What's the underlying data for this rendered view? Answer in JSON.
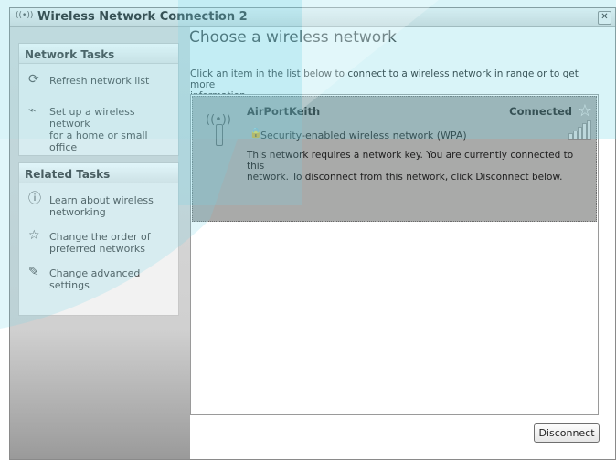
{
  "window": {
    "title": "Wireless Network Connection 2",
    "title_icon": "wireless-antenna-icon",
    "close_glyph": "✕"
  },
  "left_pane": {
    "network_tasks": {
      "header": "Network Tasks",
      "items": [
        {
          "label_lines": [
            "Refresh network list"
          ],
          "icon": "refresh-icon"
        },
        {
          "label_lines": [
            "Set up a wireless network",
            "for a home or small office"
          ],
          "icon": "setup-network-icon"
        }
      ]
    },
    "related_tasks": {
      "header": "Related Tasks",
      "items": [
        {
          "label_lines": [
            "Learn about wireless",
            "networking"
          ],
          "icon": "info-icon"
        },
        {
          "label_lines": [
            "Change the order of",
            "preferred networks"
          ],
          "icon": "star-icon"
        },
        {
          "label_lines": [
            "Change advanced",
            "settings"
          ],
          "icon": "advanced-settings-icon"
        }
      ]
    }
  },
  "main": {
    "heading": "Choose a wireless network",
    "instructions_lines": [
      "Click an item in the list below to connect to a wireless network in range or to get more",
      "information."
    ],
    "networks": [
      {
        "ssid": "AirPortKeith",
        "status": "Connected",
        "security": "Security-enabled wireless network (WPA)",
        "signal_bars": 5,
        "description_lines": [
          "This network requires a network key. You are currently connected to this",
          "network. To disconnect from this network, click Disconnect below."
        ]
      }
    ],
    "disconnect_label": "Disconnect"
  },
  "colors": {
    "selected_item_bg": "#a9aaa9",
    "overlay_cyan": "#78d7e6"
  }
}
